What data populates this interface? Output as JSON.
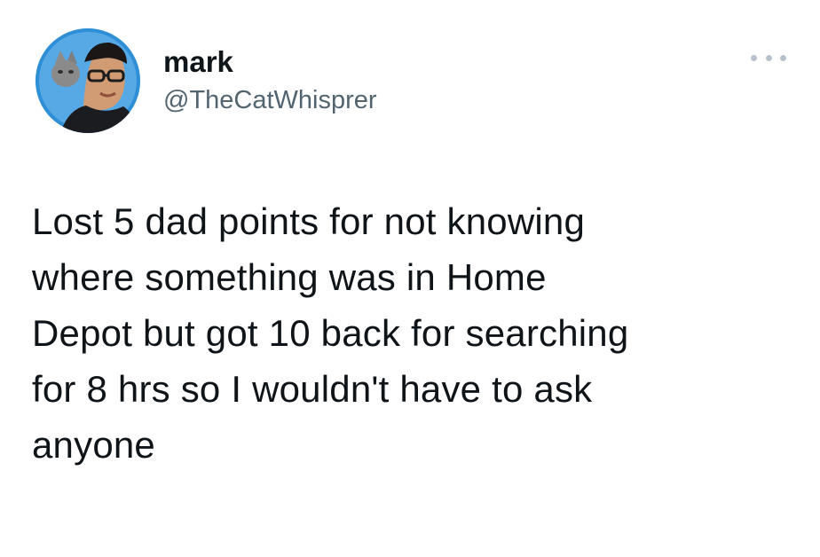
{
  "author": {
    "display_name": "mark",
    "handle": "@TheCatWhisprer",
    "avatar_icon": "profile-photo-avatar"
  },
  "menu": {
    "more_icon": "more-horizontal-icon"
  },
  "tweet": {
    "lines": [
      "Lost 5 dad points for not knowing",
      "where something was in Home",
      "Depot but got 10 back for searching",
      "for 8 hrs so I wouldn't have to ask",
      "anyone"
    ]
  },
  "colors": {
    "text_primary": "#0f1419",
    "text_secondary": "#536471",
    "avatar_background": "#2f8fd6",
    "more_dots": "#b8c2cc",
    "background": "#ffffff"
  }
}
